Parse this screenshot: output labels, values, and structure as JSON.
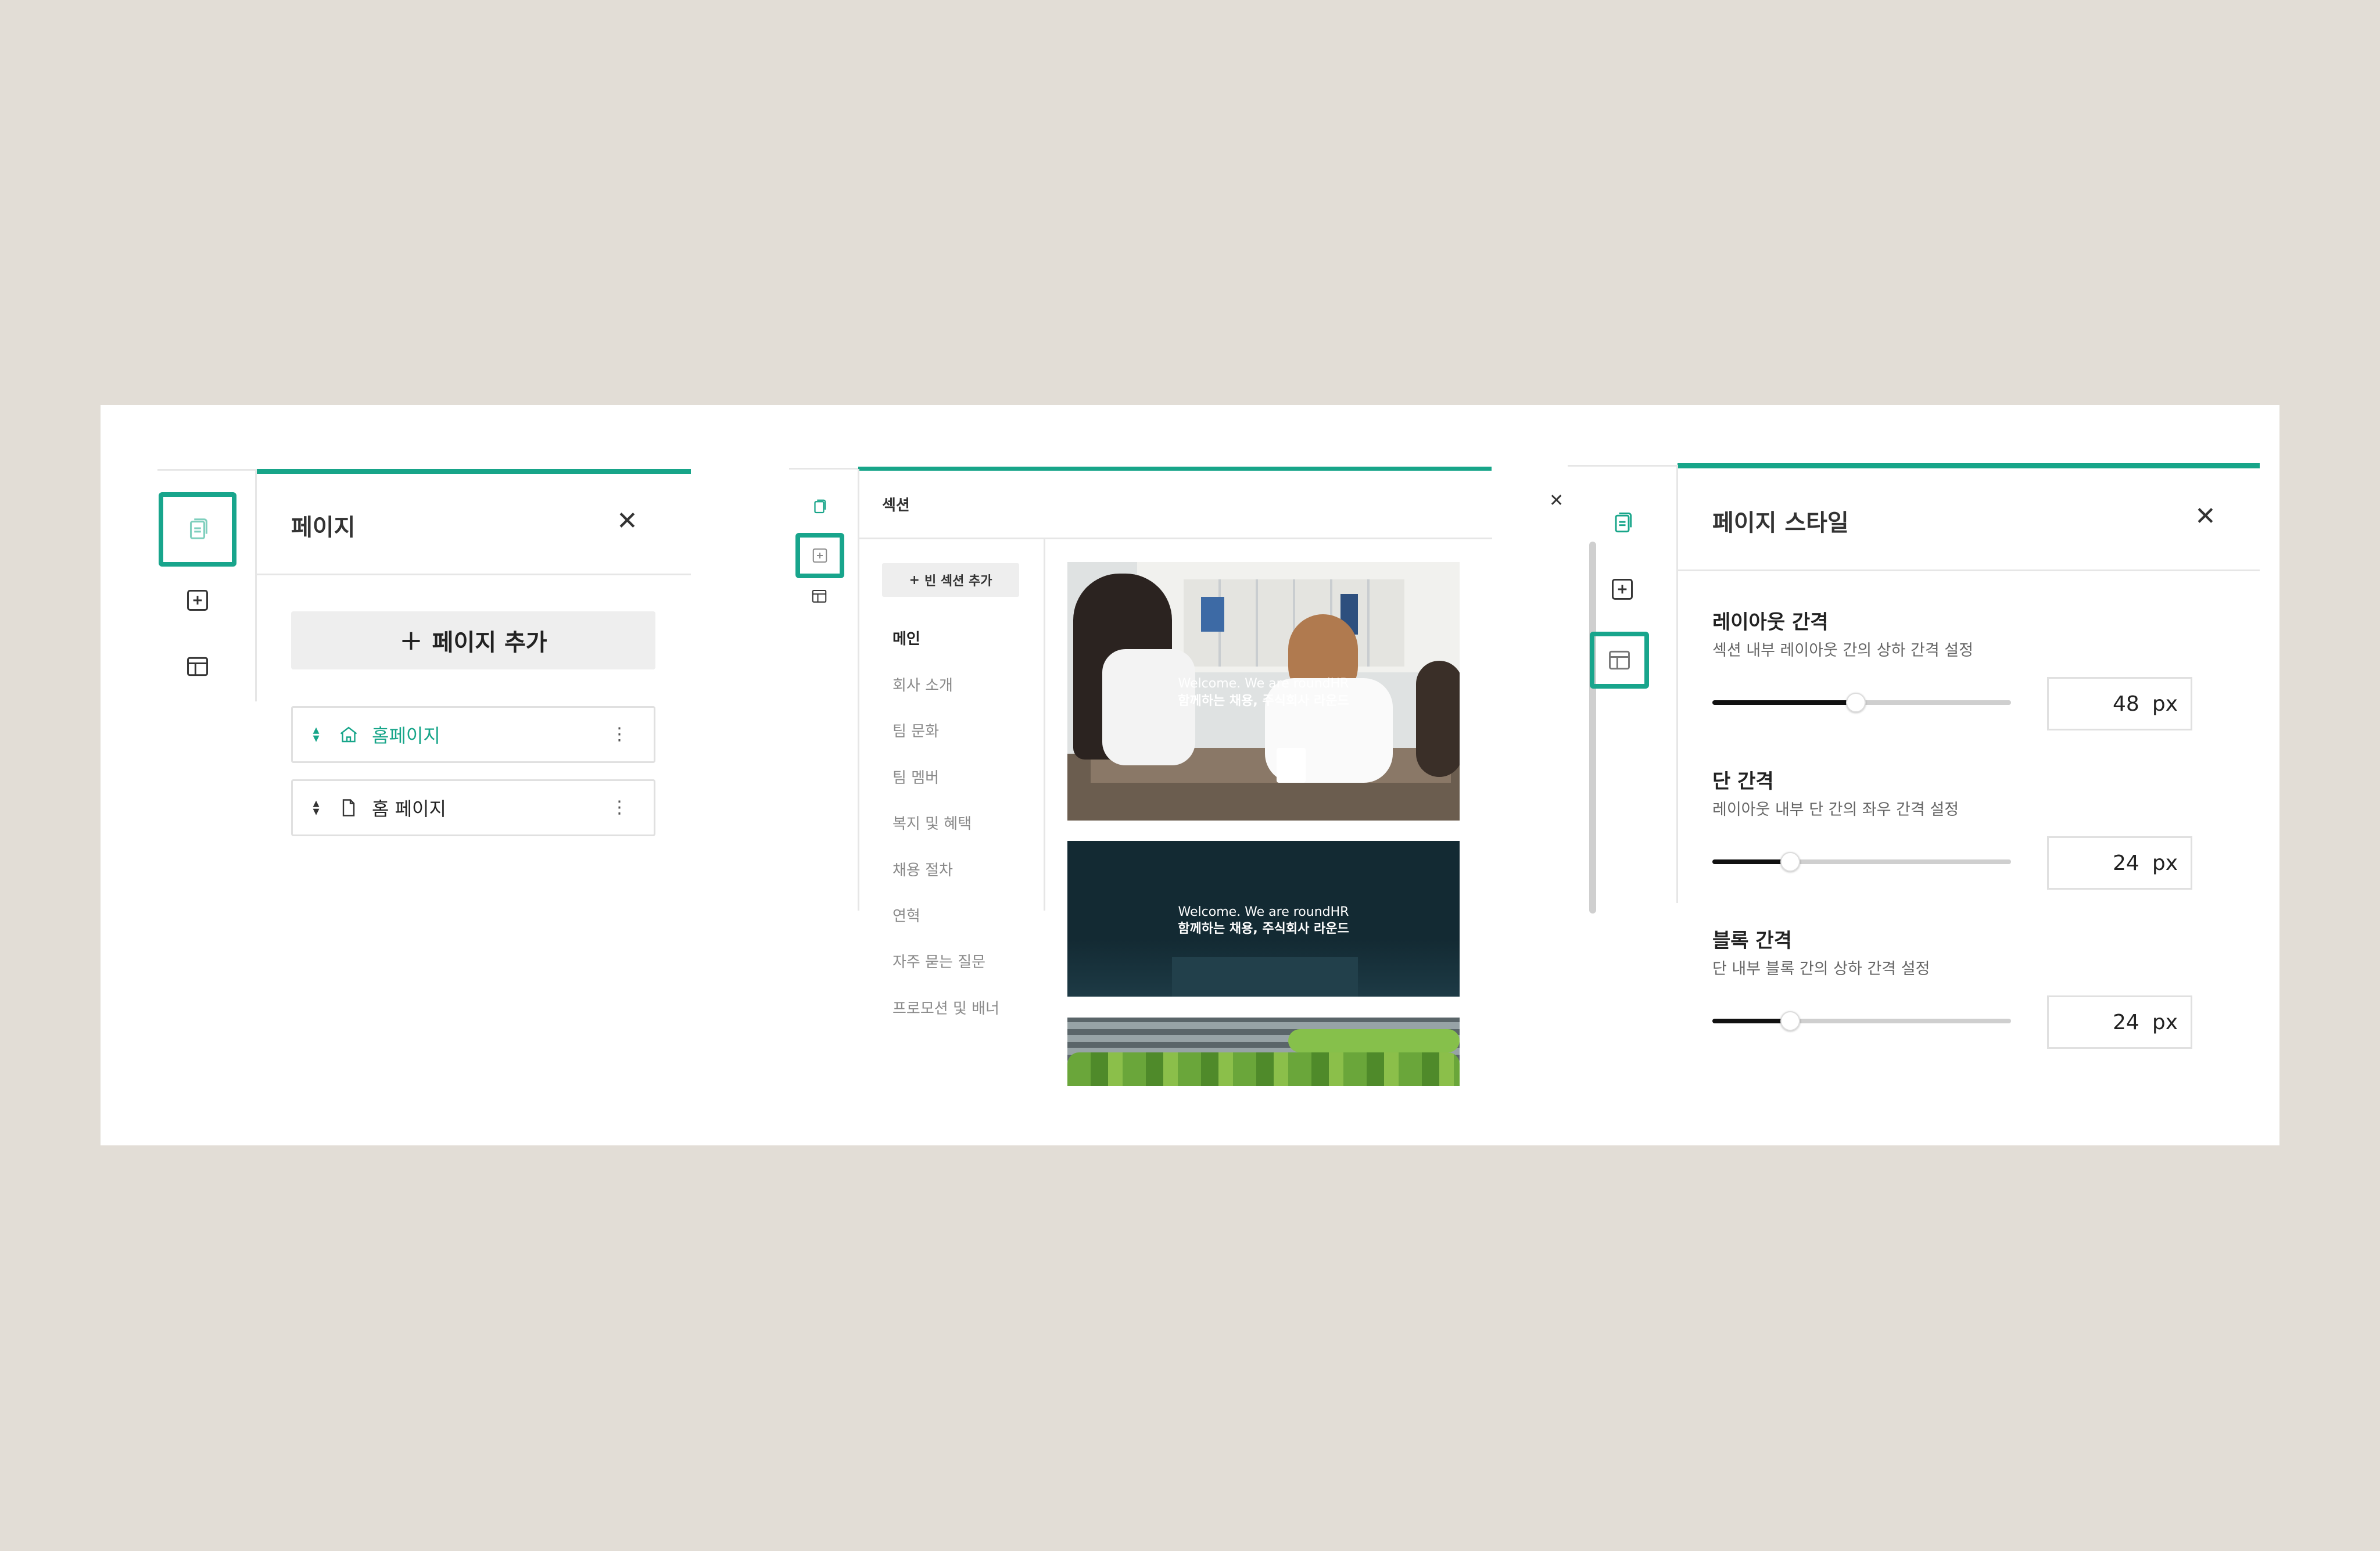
{
  "panel_pages": {
    "title": "페이지",
    "add_button": "페이지 추가",
    "pages": [
      {
        "label": "홈페이지",
        "icon": "home-icon",
        "active": true
      },
      {
        "label": "홈 페이지",
        "icon": "page-icon",
        "active": false
      }
    ]
  },
  "panel_sections": {
    "title": "섹션",
    "add_blank": "빈 섹션 추가",
    "categories": [
      "메인",
      "회사 소개",
      "팀 문화",
      "팀 멤버",
      "복지 및 혜택",
      "채용 절차",
      "연혁",
      "자주 묻는 질문",
      "프로모션 및 배너"
    ],
    "active_category": "메인",
    "thumb1_line1": "Welcome. We are roundHR",
    "thumb1_line2": "함께하는 채용, 주식회사 라운드",
    "thumb2_line1": "Welcome. We are roundHR",
    "thumb2_line2": "함께하는 채용, 주식회사 라운드"
  },
  "panel_style": {
    "title": "페이지 스타일",
    "unit": "px",
    "settings": [
      {
        "label": "레이아웃 간격",
        "desc": "섹션 내부 레이아웃 간의 상하 간격 설정",
        "value": "48",
        "level": 0.48
      },
      {
        "label": "단 간격",
        "desc": "레이아웃 내부 단 간의 좌우 간격 설정",
        "value": "24",
        "level": 0.26
      },
      {
        "label": "블록 간격",
        "desc": "단 내부 블록 간의 상하 간격 설정",
        "value": "24",
        "level": 0.26
      }
    ]
  },
  "colors": {
    "accent": "#17a589",
    "background": "#e2ddd6"
  }
}
